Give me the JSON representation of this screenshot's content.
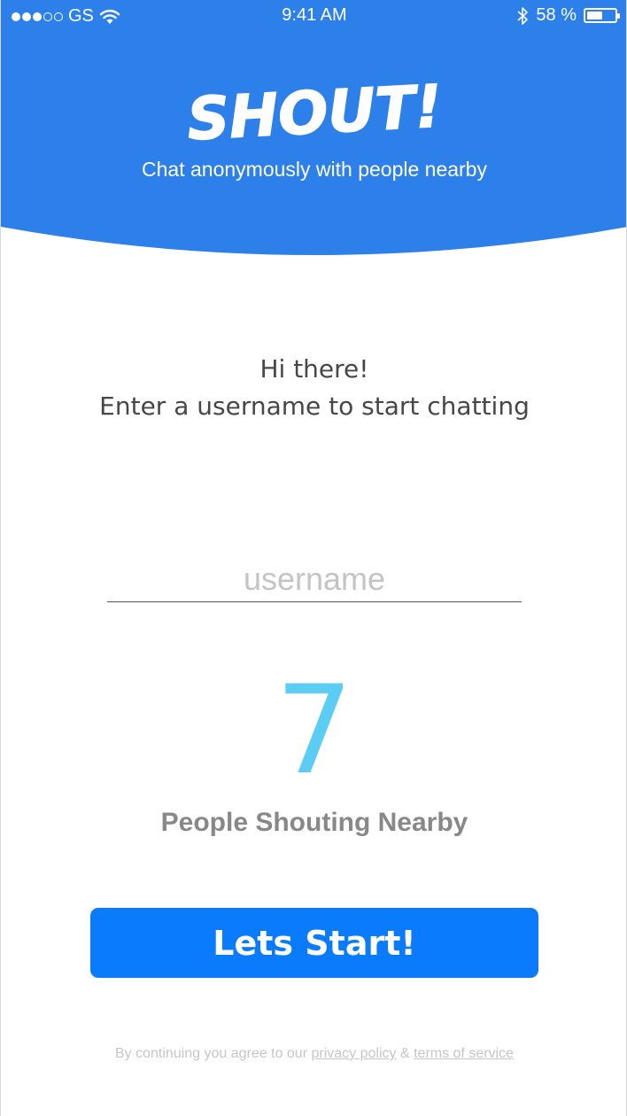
{
  "colors": {
    "header_blue": "#2d80ea",
    "button_blue": "#0a7bfc",
    "count_cyan": "#5bcdf5",
    "greeting_text": "#474747",
    "label_grey": "#888888",
    "footer_grey": "#c6c6c6"
  },
  "status_bar": {
    "carrier": "GS",
    "signal_bars_filled": 3,
    "signal_bars_total": 5,
    "time": "9:41 AM",
    "battery_percent": "58 %",
    "battery_level": 0.58,
    "icons": [
      "signal-dots-icon",
      "wifi-icon",
      "bluetooth-icon",
      "battery-icon"
    ]
  },
  "header": {
    "logo_text": "SHOUT!",
    "tagline": "Chat anonymously with people nearby"
  },
  "main": {
    "greeting_line1": "Hi there!",
    "greeting_line2": "Enter a username to start chatting",
    "username_placeholder": "username",
    "username_value": "",
    "people_count": "7",
    "people_label": "People Shouting Nearby",
    "start_button_label": "Lets Start!"
  },
  "footer": {
    "prefix": "By continuing you agree to our ",
    "privacy_link": "privacy policy",
    "separator": " & ",
    "terms_link": "terms of service"
  }
}
